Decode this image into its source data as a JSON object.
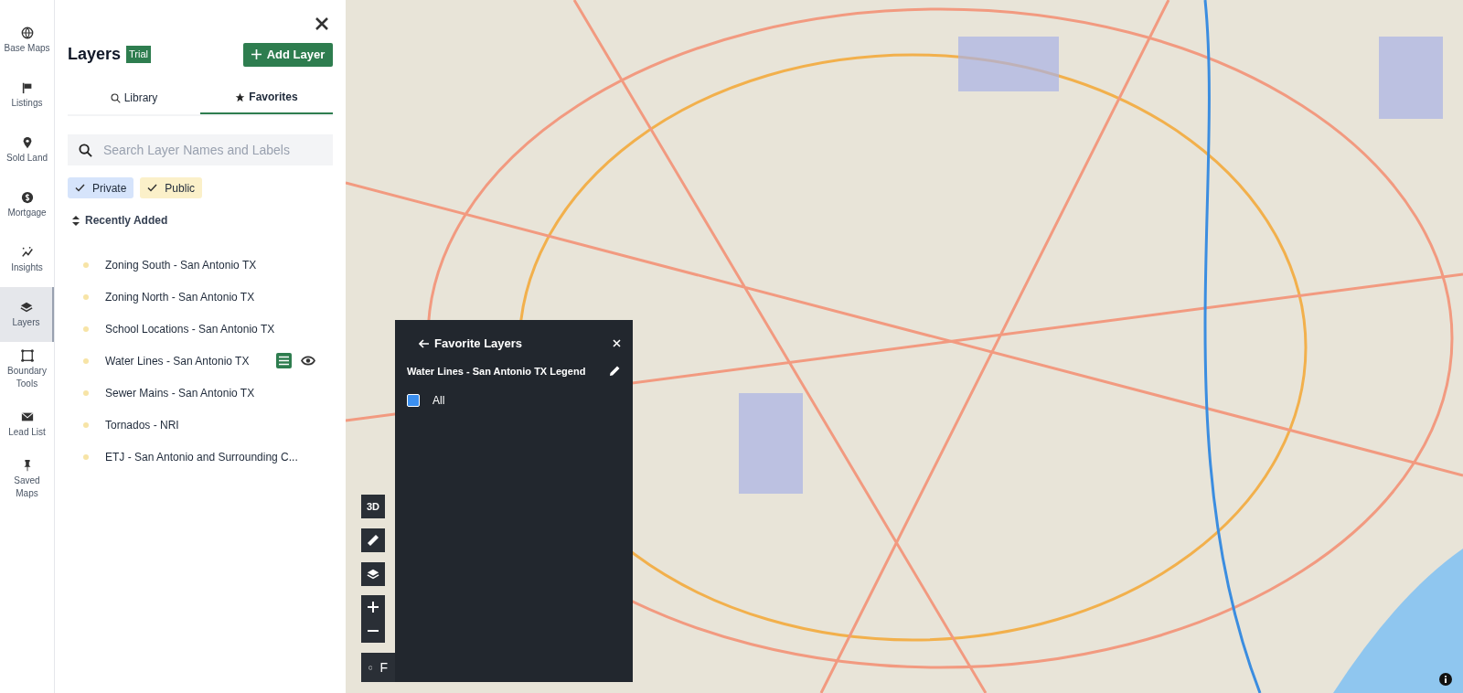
{
  "nav": [
    {
      "label": "Base Maps",
      "selected": false
    },
    {
      "label": "Listings",
      "selected": false
    },
    {
      "label": "Sold Land",
      "selected": false
    },
    {
      "label": "Mortgage",
      "selected": false
    },
    {
      "label": "Insights",
      "selected": false
    },
    {
      "label": "Layers",
      "selected": true
    },
    {
      "label": "Boundary Tools",
      "selected": false
    },
    {
      "label": "Lead List",
      "selected": false
    },
    {
      "label": "Saved Maps",
      "selected": false
    }
  ],
  "panel": {
    "title": "Layers",
    "badge": "Trial",
    "add_button": "Add Layer",
    "tabs": [
      {
        "label": "Library",
        "selected": false
      },
      {
        "label": "Favorites",
        "selected": true
      }
    ],
    "search": {
      "placeholder": "Search Layer Names and Labels"
    },
    "filters": [
      {
        "label": "Private",
        "kind": "private",
        "checked": true
      },
      {
        "label": "Public",
        "kind": "public",
        "checked": true
      }
    ],
    "sort": "Recently Added",
    "layers": [
      {
        "name": "Zoning South - San Antonio TX",
        "actions": false
      },
      {
        "name": "Zoning North - San Antonio TX",
        "actions": false
      },
      {
        "name": "School Locations - San Antonio TX",
        "actions": false
      },
      {
        "name": "Water Lines - San Antonio TX",
        "actions": true
      },
      {
        "name": "Sewer Mains - San Antonio TX",
        "actions": false
      },
      {
        "name": "Tornados - NRI",
        "actions": false
      },
      {
        "name": "ETJ - San Antonio and Surrounding C..."
      }
    ]
  },
  "map_controls": [
    {
      "kind": "text",
      "label": "3D"
    },
    {
      "kind": "ruler"
    },
    {
      "kind": "layers"
    }
  ],
  "partial_button": "F",
  "legend": {
    "title": "Favorite Layers",
    "subtitle": "Water Lines - San Antonio TX Legend",
    "items": [
      {
        "label": "All",
        "checked": true
      }
    ]
  }
}
